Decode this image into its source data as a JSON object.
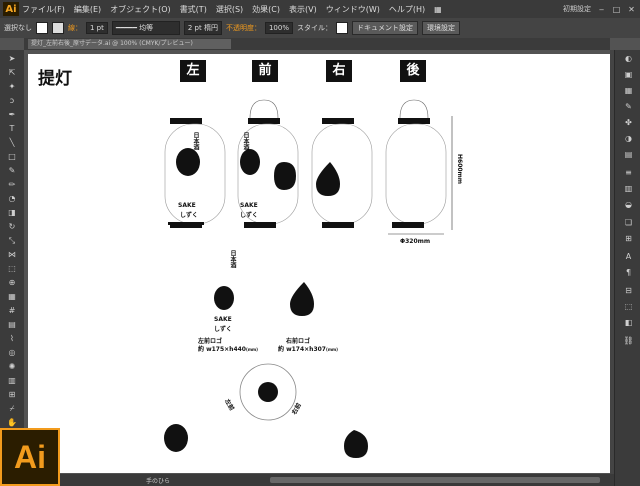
{
  "app": {
    "logo_text": "Ai",
    "workspace": "初期設定"
  },
  "menu": [
    "ファイル(F)",
    "編集(E)",
    "オブジェクト(O)",
    "書式(T)",
    "選択(S)",
    "効果(C)",
    "表示(V)",
    "ウィンドウ(W)",
    "ヘルプ(H)"
  ],
  "control": {
    "selection": "選択なし",
    "stroke_label": "線：",
    "stroke_weight": "1 pt",
    "stroke_style": "均等",
    "brush": "2 pt 楕円",
    "opacity_label": "不透明度：",
    "opacity": "100%",
    "style_label": "スタイル：",
    "doc_setup": "ドキュメント設定",
    "prefs": "環境設定"
  },
  "tab": {
    "label": "提灯_左前右後_原寸データ.ai @ 100% (CMYK/プレビュー)"
  },
  "artboard": {
    "title": "提灯",
    "views": [
      "左",
      "前",
      "右",
      "後"
    ],
    "height_dim": "H600mm",
    "width_dim": "Φ320mm",
    "lantern_text": {
      "line1": "日本酒",
      "sake": "SAKE",
      "shizuku": "しずく"
    },
    "logo_left": {
      "name": "左前ロゴ",
      "size": "約 w175×h440",
      "unit": "(mm)"
    },
    "logo_right": {
      "name": "右前ロゴ",
      "size": "約 w174×h307",
      "unit": "(mm)"
    },
    "dev_left": "左前",
    "dev_right": "右前"
  },
  "status": {
    "tool_name": "手のひら"
  },
  "icons": {
    "accent": "#f29b1d"
  }
}
